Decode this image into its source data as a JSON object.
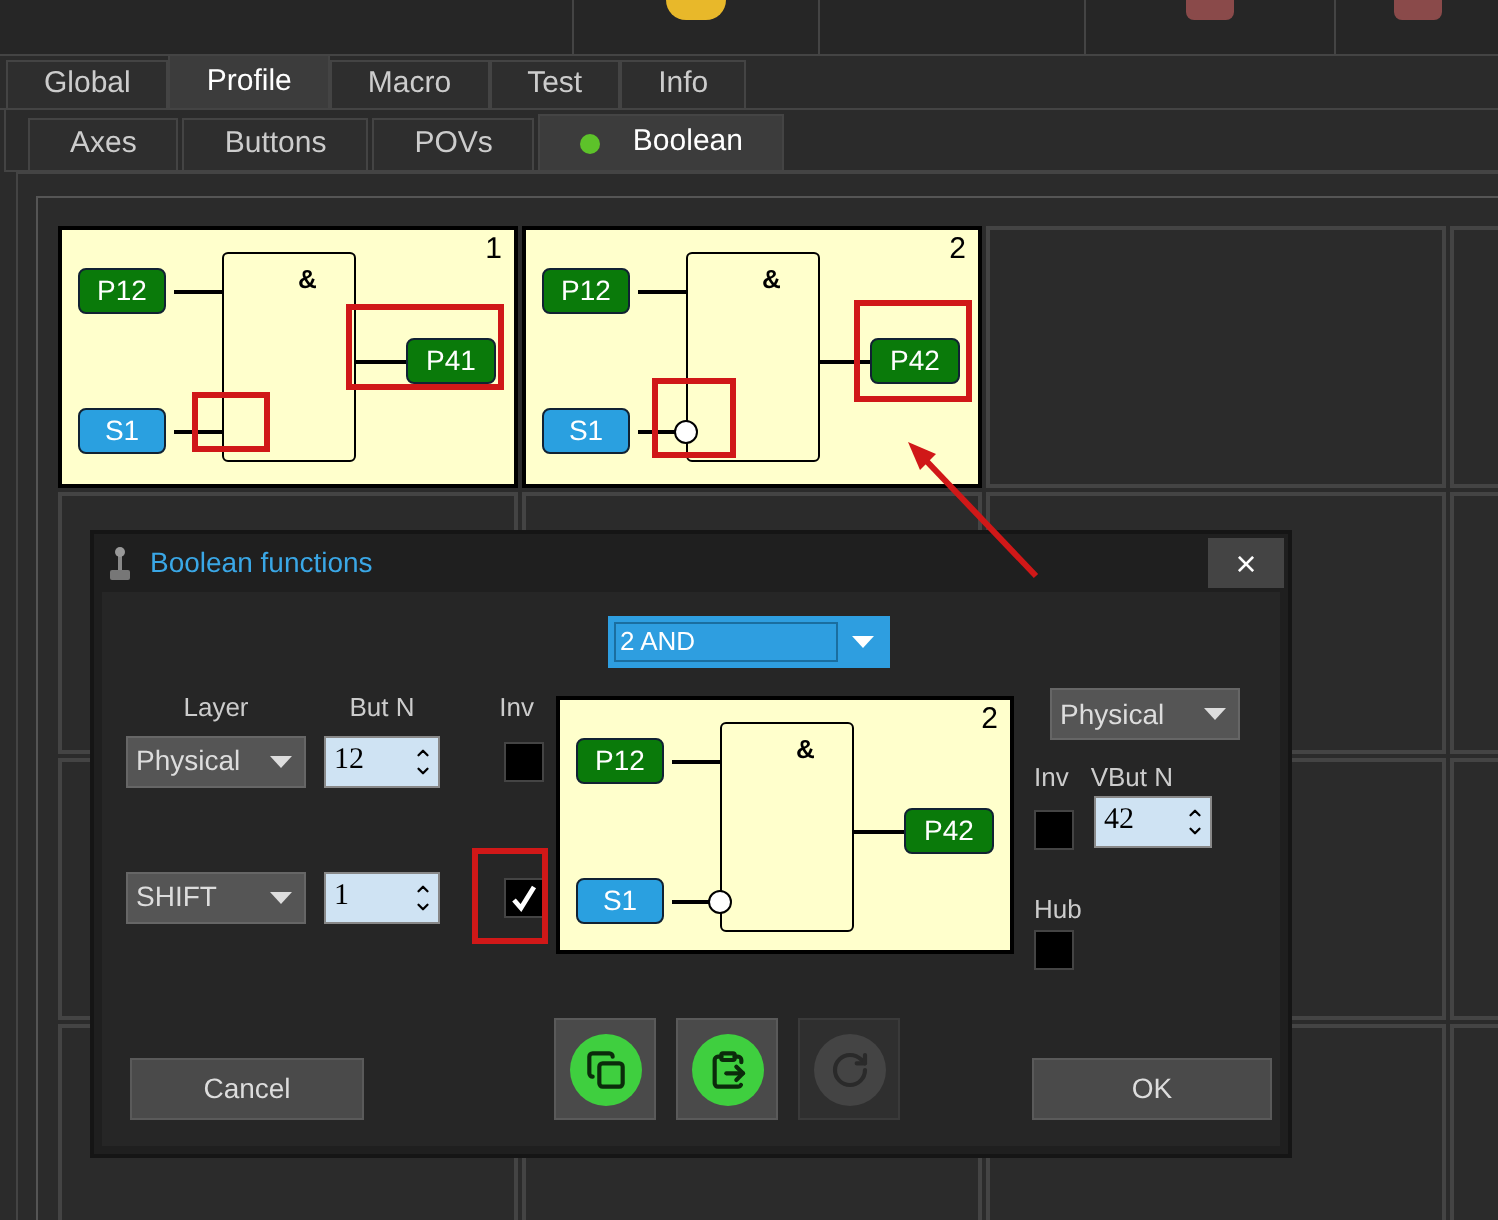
{
  "tabs": [
    {
      "label": "Global",
      "selected": false
    },
    {
      "label": "Profile",
      "selected": true
    },
    {
      "label": "Macro",
      "selected": false
    },
    {
      "label": "Test",
      "selected": false
    },
    {
      "label": "Info",
      "selected": false
    }
  ],
  "subtabs": [
    {
      "label": "Axes",
      "selected": false,
      "indicator": false
    },
    {
      "label": "Buttons",
      "selected": false,
      "indicator": false
    },
    {
      "label": "POVs",
      "selected": false,
      "indicator": false
    },
    {
      "label": "Boolean",
      "selected": true,
      "indicator": true
    }
  ],
  "functions": [
    {
      "number": "1",
      "gate": "&",
      "inputs": [
        {
          "label": "P12",
          "color": "#0a7a0a",
          "inverted": false
        },
        {
          "label": "S1",
          "color": "#2aa0e0",
          "inverted": false
        }
      ],
      "output": {
        "label": "P41",
        "color": "#0a7a0a"
      }
    },
    {
      "number": "2",
      "gate": "&",
      "inputs": [
        {
          "label": "P12",
          "color": "#0a7a0a",
          "inverted": false
        },
        {
          "label": "S1",
          "color": "#2aa0e0",
          "inverted": true
        }
      ],
      "output": {
        "label": "P42",
        "color": "#0a7a0a"
      }
    }
  ],
  "dialog": {
    "title": "Boolean functions",
    "close": "×",
    "function_type": "2 AND",
    "headers": {
      "layer": "Layer",
      "button": "But N",
      "inv": "Inv"
    },
    "rows": [
      {
        "layer": "Physical",
        "button": "12",
        "inv_checked": false
      },
      {
        "layer": "SHIFT",
        "button": "1",
        "inv_checked": true
      }
    ],
    "diagram": {
      "number": "2",
      "gate": "&",
      "inputs": [
        {
          "label": "P12",
          "color": "#0a7a0a",
          "inverted": false
        },
        {
          "label": "S1",
          "color": "#2aa0e0",
          "inverted": true
        }
      ],
      "output": {
        "label": "P42",
        "color": "#0a7a0a"
      }
    },
    "output_layer": "Physical",
    "inv_label": "Inv",
    "vbut_label": "VBut N",
    "vbut_value": "42",
    "inv_checked": false,
    "hub_label": "Hub",
    "hub_checked": false,
    "tools": [
      {
        "kind": "copy",
        "disabled": false
      },
      {
        "kind": "paste",
        "disabled": false
      },
      {
        "kind": "reset",
        "disabled": true
      }
    ],
    "cancel": "Cancel",
    "ok": "OK"
  }
}
